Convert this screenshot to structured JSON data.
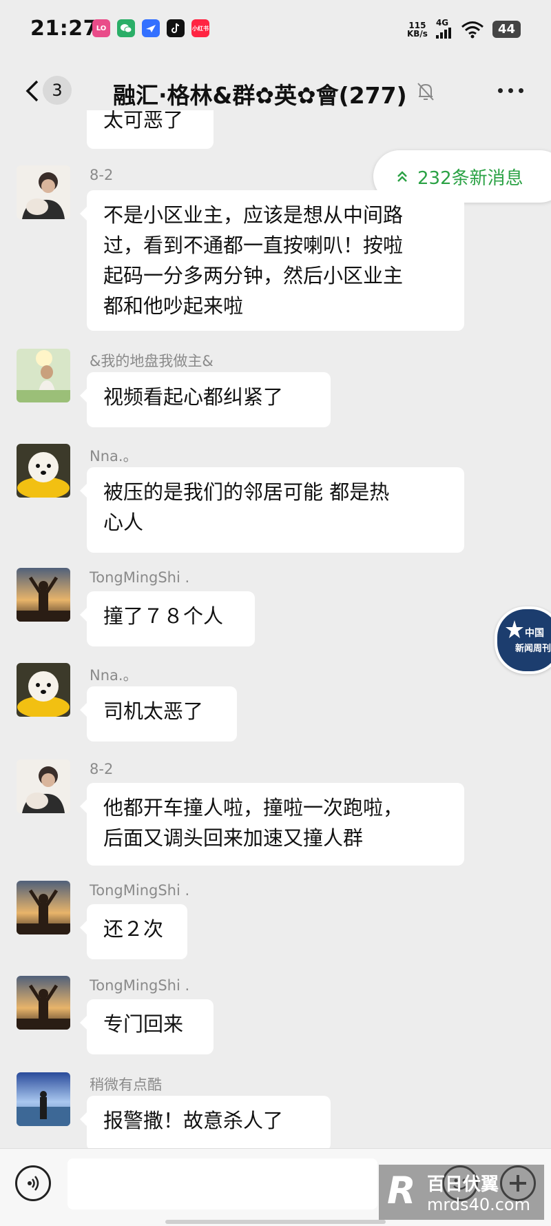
{
  "status_bar": {
    "time": "21:27",
    "app_icons": [
      {
        "name": "lofter-icon",
        "label": "LOFTER",
        "color": "#e94c89"
      },
      {
        "name": "wechat-icon",
        "label": "",
        "color": "#2aae67"
      },
      {
        "name": "feishu-icon",
        "label": "",
        "color": "#3370ff"
      },
      {
        "name": "tiktok-icon",
        "label": "",
        "color": "#111111"
      },
      {
        "name": "xiaohongshu-icon",
        "label": "小红书",
        "color": "#ff2442"
      }
    ],
    "net_speed_value": "115",
    "net_speed_unit": "KB/s",
    "network": "4G",
    "battery": "44"
  },
  "header": {
    "unread_count": "3",
    "title": "融汇·格林&群✿英✿會(277)"
  },
  "new_messages_pill": "232条新消息",
  "partial_bubble_text": "太可恶了",
  "messages": [
    {
      "sender": "8-2",
      "text_lines": [
        "不是小区业主，应该是想从中间路",
        "过，看到不通都一直按喇叭！按啦",
        "起码一分多两分钟，然后小区业主",
        "都和他吵起来啦"
      ]
    },
    {
      "sender": "&我的地盘我做主&",
      "text_lines": [
        "视频看起心都纠紧了"
      ]
    },
    {
      "sender": "Nna.。",
      "text_lines": [
        "被压的是我们的邻居可能 都是热",
        "心人"
      ]
    },
    {
      "sender": "TongMingShi .",
      "text_lines": [
        "撞了７８个人"
      ]
    },
    {
      "sender": "Nna.。",
      "text_lines": [
        "司机太恶了"
      ]
    },
    {
      "sender": "8-2",
      "text_lines": [
        "他都开车撞人啦，撞啦一次跑啦，",
        "后面又调头回来加速又撞人群"
      ]
    },
    {
      "sender": "TongMingShi .",
      "text_lines": [
        "还２次"
      ]
    },
    {
      "sender": "TongMingShi .",
      "text_lines": [
        "专门回来"
      ]
    },
    {
      "sender": "稍微有点酷",
      "text_lines": [
        "报警撒！故意杀人了"
      ]
    }
  ],
  "news_badge": {
    "line1": "中国",
    "line2": "新闻周刊"
  },
  "watermark": {
    "line1": "百日伏翼",
    "line2": "mrds40.com"
  },
  "colors": {
    "accent_green": "#2ba245",
    "background": "#ededed",
    "bubble": "#ffffff"
  }
}
